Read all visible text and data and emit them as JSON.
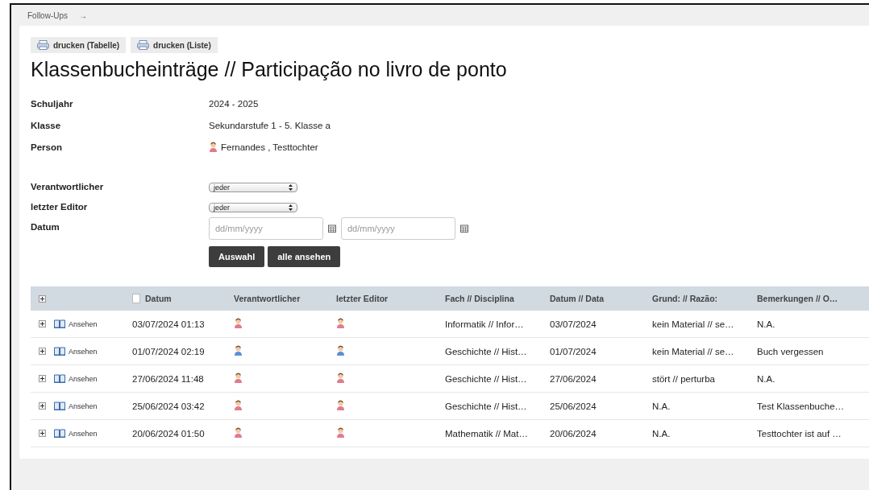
{
  "breadcrumb": {
    "label": "Follow-Ups",
    "arrow": "→"
  },
  "print_buttons": [
    "drucken (Tabelle)",
    "drucken (Liste)"
  ],
  "title": "Klassenbucheinträge // Participação no livro de ponto",
  "info": [
    {
      "label": "Schuljahr",
      "value": "2024 - 2025"
    },
    {
      "label": "Klasse",
      "value": "Sekundarstufe 1 - 5. Klasse a"
    },
    {
      "label": "Person",
      "value": "Fernandes , Testtochter",
      "avatar_male": false
    }
  ],
  "filters": [
    {
      "kind": "select",
      "label": "Verantwortlicher",
      "value": "jeder"
    },
    {
      "kind": "select",
      "label": "letzter Editor",
      "value": "jeder"
    },
    {
      "kind": "daterange",
      "label": "Datum",
      "placeholders": [
        "dd/mm/yyyy",
        "dd/mm/yyyy"
      ]
    }
  ],
  "actions": [
    "Auswahl",
    "alle ansehen"
  ],
  "table": {
    "columns": [
      "Datum",
      "Verantwortlicher",
      "letzter Editor",
      "Fach // Disciplina",
      "Datum // Data",
      "Grund: // Razão:",
      "Bemerkungen // O…"
    ],
    "rows": [
      {
        "view": "Ansehen",
        "datum": "03/07/2024 01:13",
        "responsible_male": false,
        "editor_male": false,
        "fach": "Informatik // Infor…",
        "date": "03/07/2024",
        "grund": "kein Material // se…",
        "bemerkung": "N.A."
      },
      {
        "view": "Ansehen",
        "datum": "01/07/2024 02:19",
        "responsible_male": true,
        "editor_male": true,
        "fach": "Geschichte // Hist…",
        "date": "01/07/2024",
        "grund": "kein Material // se…",
        "bemerkung": "Buch vergessen"
      },
      {
        "view": "Ansehen",
        "datum": "27/06/2024 11:48",
        "responsible_male": false,
        "editor_male": false,
        "fach": "Geschichte // Hist…",
        "date": "27/06/2024",
        "grund": "stört // perturba",
        "bemerkung": "N.A."
      },
      {
        "view": "Ansehen",
        "datum": "25/06/2024 03:42",
        "responsible_male": false,
        "editor_male": false,
        "fach": "Geschichte // Hist…",
        "date": "25/06/2024",
        "grund": "N.A.",
        "bemerkung": "Test Klassenbuche…"
      },
      {
        "view": "Ansehen",
        "datum": "20/06/2024 01:50",
        "responsible_male": false,
        "editor_male": false,
        "fach": "Mathematik // Mat…",
        "date": "20/06/2024",
        "grund": "N.A.",
        "bemerkung": "Testtochter ist auf …"
      }
    ]
  }
}
